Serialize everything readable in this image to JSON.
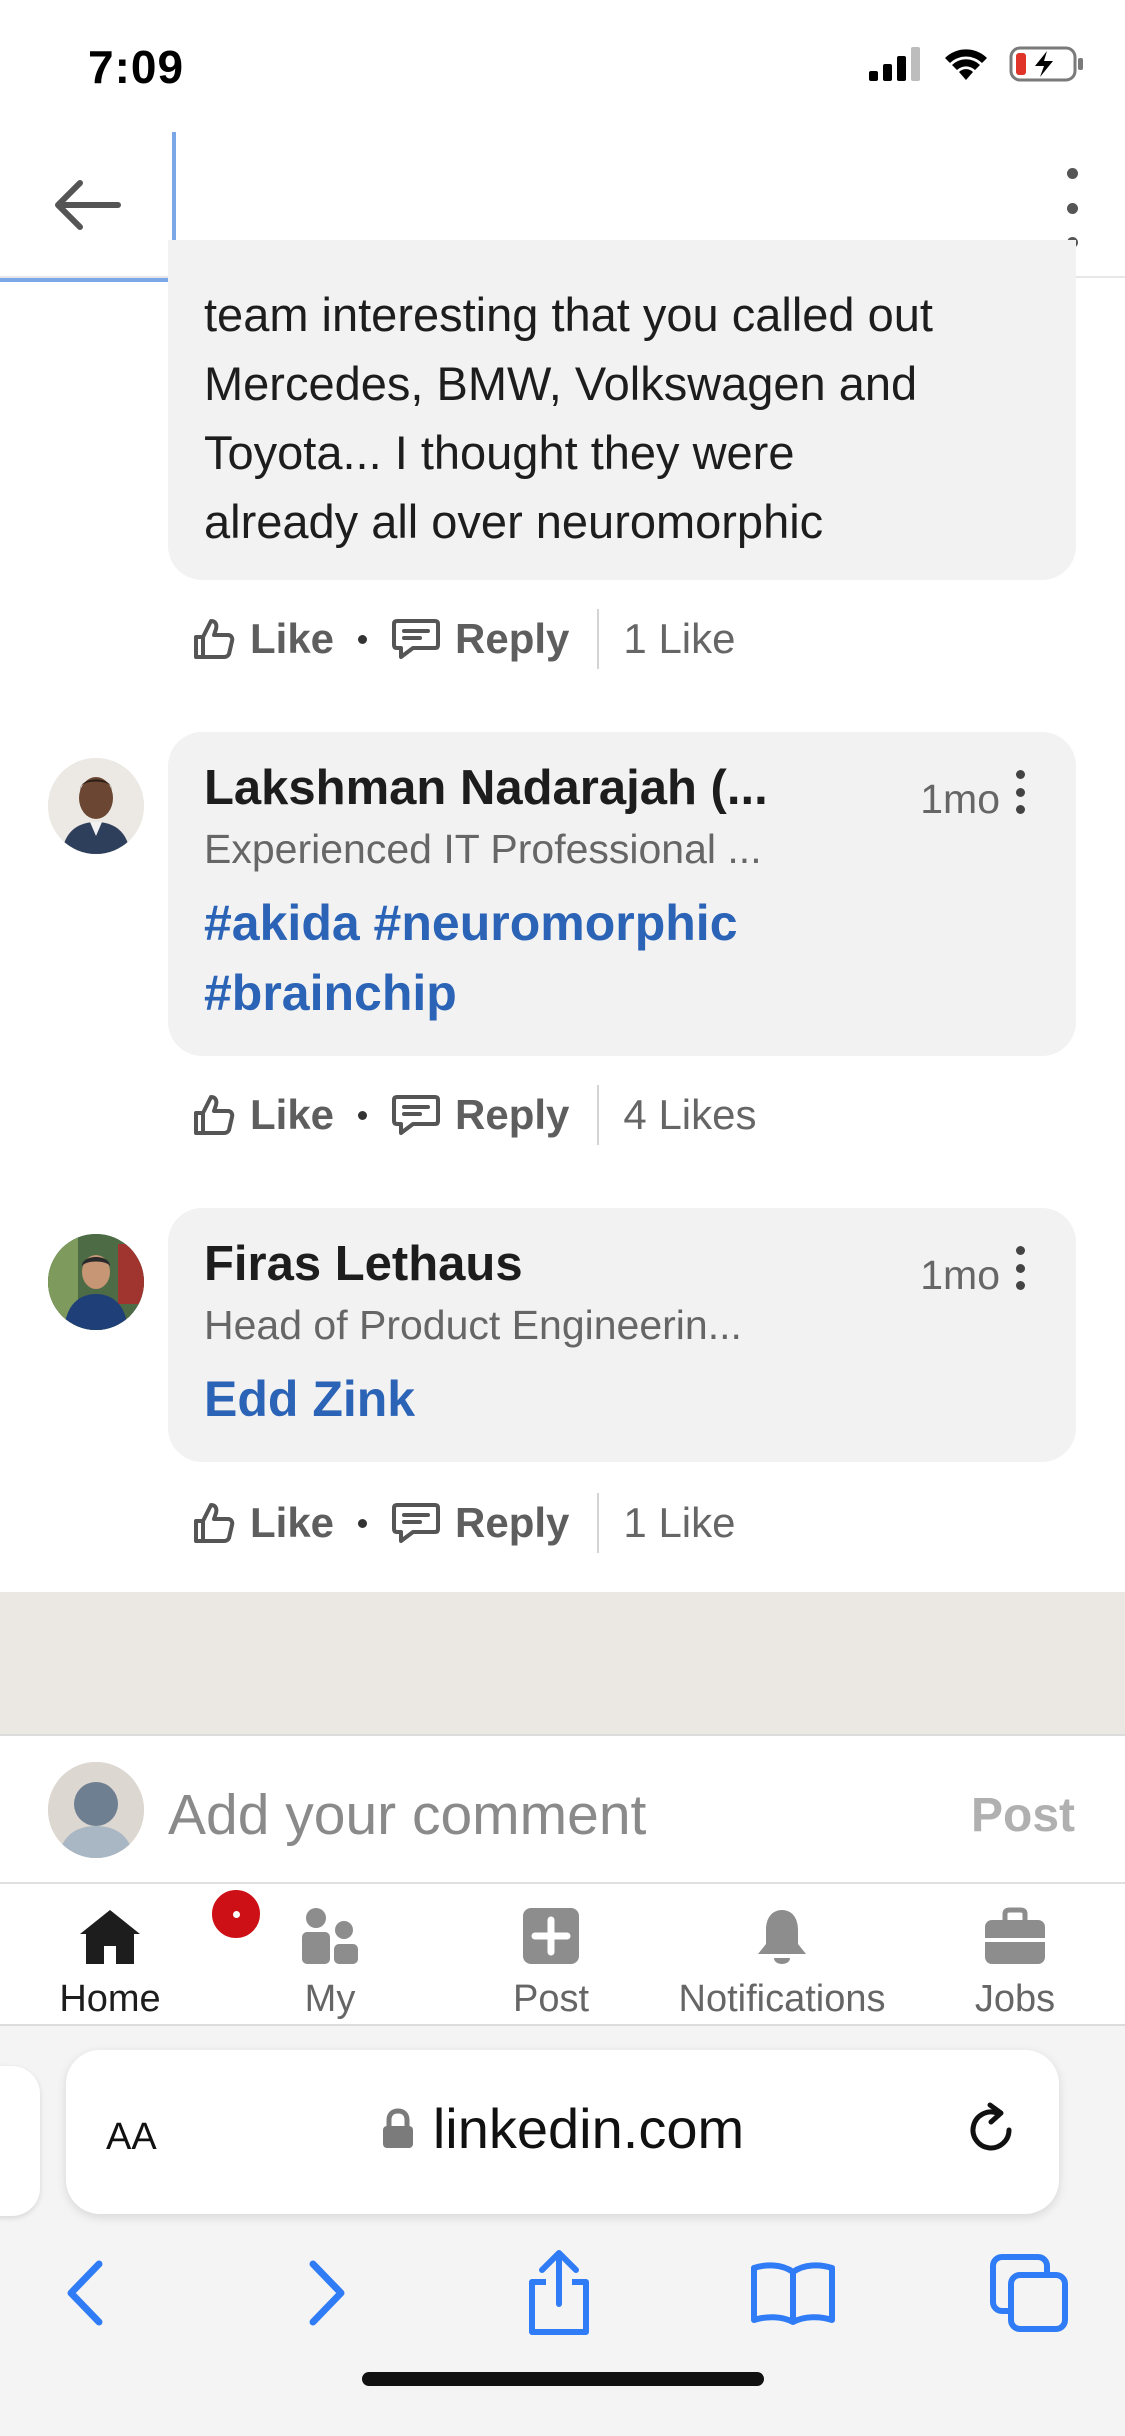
{
  "status_bar": {
    "time": "7:09"
  },
  "first_comment": {
    "lines": [
      "team interesting that you called out",
      "Mercedes, BMW, Volkswagen and",
      "Toyota... I thought they were",
      "already all over neuromorphic"
    ],
    "like_label": "Like",
    "reply_label": "Reply",
    "likes_count": "1 Like"
  },
  "comments": [
    {
      "name": "Lakshman Nadarajah (...",
      "time": "1mo",
      "headline": "Experienced IT Professional ...",
      "body_lines": [
        "#akida #neuromorphic",
        "#brainchip"
      ],
      "like_label": "Like",
      "reply_label": "Reply",
      "likes_count": "4 Likes"
    },
    {
      "name": "Firas Lethaus",
      "time": "1mo",
      "headline": "Head of Product Engineerin...",
      "body_lines": [
        "Edd Zink"
      ],
      "like_label": "Like",
      "reply_label": "Reply",
      "likes_count": "1 Like"
    }
  ],
  "comment_input": {
    "placeholder": "Add your comment",
    "post_label": "Post"
  },
  "app_nav": {
    "items": [
      {
        "label": "Home",
        "icon": "home-icon",
        "active": true
      },
      {
        "label": "My",
        "icon": "my-network-icon",
        "active": false
      },
      {
        "label": "Post",
        "icon": "post-plus-icon",
        "active": false
      },
      {
        "label": "Notifications",
        "icon": "bell-icon",
        "active": false
      },
      {
        "label": "Jobs",
        "icon": "briefcase-icon",
        "active": false
      }
    ]
  },
  "browser": {
    "aa_label": "AA",
    "url": "linkedin.com"
  },
  "colors": {
    "link_blue": "#2b63b6",
    "badge_red": "#cc1016",
    "safari_blue": "#2f7cf6"
  }
}
